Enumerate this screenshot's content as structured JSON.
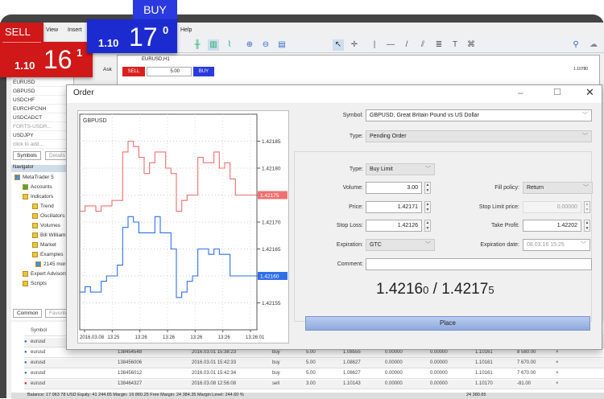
{
  "menu": [
    "View",
    "Insert",
    "Help"
  ],
  "one_click": {
    "sell_label": "SELL",
    "sell_big": "1.10",
    "sell_digits": "16",
    "sell_sup": "1",
    "buy_label": "BUY",
    "buy_big": "1.10",
    "buy_digits": "17",
    "buy_sup": "0"
  },
  "bg_chart": {
    "title": "EURUSD,H1",
    "sell": "SELL",
    "volume": "5.00",
    "buy": "BUY",
    "price_label": "1.10780",
    "ask_header": "Ask"
  },
  "market_watch": {
    "symbols": [
      "EURUSD",
      "GBPUSD",
      "USDCHF",
      "EURCHFCNH",
      "USDCADCT",
      "FORTS-USDR...",
      "USDJPY"
    ],
    "add": "click to add...",
    "tabs": [
      "Symbols",
      "Details"
    ]
  },
  "navigator": {
    "title": "Navigator",
    "items": [
      "MetaTrader 5",
      "Accounts",
      "Indicators",
      "Trend",
      "Oscillators",
      "Volumes",
      "Bill Williams",
      "Market",
      "Examples",
      "2145 more...",
      "Expert Advisors",
      "Scripts"
    ],
    "tabs": [
      "Common",
      "Favorites"
    ]
  },
  "dialog": {
    "title": "Order",
    "symbol_label": "Symbol:",
    "symbol_value": "GBPUSD, Great Britain Pound vs US Dollar",
    "type_label": "Type:",
    "type_value": "Pending Order",
    "order_type_label": "Type:",
    "order_type_value": "Buy Limit",
    "volume_label": "Volume:",
    "volume_value": "3.00",
    "fill_label": "Fill policy:",
    "fill_value": "Return",
    "price_label": "Price:",
    "price_value": "1.42171",
    "stop_limit_label": "Stop Limit price:",
    "stop_limit_value": "0.00000",
    "sl_label": "Stop Loss:",
    "sl_value": "1.42126",
    "tp_label": "Take Profit:",
    "tp_value": "1.42202",
    "exp_label": "Expiration:",
    "exp_value": "GTC",
    "exp_date_label": "Expiration date:",
    "exp_date_value": "08.03.16 15:25",
    "comment_label": "Comment:",
    "comment_value": "",
    "bid_main": "1.4216",
    "bid_small": "0",
    "sep": " / ",
    "ask_main": "1.4217",
    "ask_small": "5",
    "place_label": "Place"
  },
  "chart_data": {
    "type": "line",
    "title": "GBPUSD",
    "x_tick_labels": [
      "2016.03.08",
      "13:25",
      "13:26",
      "13:26",
      "13:26",
      "13:26",
      "13:26:01"
    ],
    "y_ticks": [
      1.42155,
      1.4216,
      1.42165,
      1.4217,
      1.42175,
      1.4218,
      1.42185
    ],
    "ylim": [
      1.4215,
      1.4219
    ],
    "grid": true,
    "current_ask_label": "1.42175",
    "current_bid_label": "1.42160",
    "series": [
      {
        "color": "#f07070",
        "values": [
          1.42172,
          1.42173,
          1.42173,
          1.42172,
          1.42173,
          1.42173,
          1.42174,
          1.42174,
          1.42183,
          1.42185,
          1.42184,
          1.42182,
          1.42179,
          1.42181,
          1.42183,
          1.42183,
          1.4218,
          1.42179,
          1.42172,
          1.42174,
          1.42175,
          1.42175,
          1.42182,
          1.42181,
          1.42181,
          1.42183,
          1.4218,
          1.42181,
          1.42178,
          1.42175,
          1.42175,
          1.42175,
          1.42175,
          1.42175
        ]
      },
      {
        "color": "#2f6fe8",
        "values": [
          1.42157,
          1.42158,
          1.42157,
          1.42157,
          1.42159,
          1.4216,
          1.4216,
          1.42162,
          1.42169,
          1.42171,
          1.4217,
          1.42168,
          1.42168,
          1.42168,
          1.42171,
          1.42168,
          1.42168,
          1.42165,
          1.42156,
          1.42157,
          1.42159,
          1.4216,
          1.42165,
          1.42165,
          1.42164,
          1.42165,
          1.42164,
          1.42164,
          1.4216,
          1.4216,
          1.4216,
          1.4216,
          1.4216,
          1.4216
        ]
      }
    ]
  },
  "toolbox": {
    "header": "Symbol",
    "rows": [
      [
        "eurusd",
        "",
        "",
        "",
        "",
        "",
        "",
        "",
        "",
        ""
      ],
      [
        "eurusd",
        "138454548",
        "2016.03.01 15:38:23",
        "buy",
        "5.00",
        "1.08555",
        "0.00000",
        "0.00000",
        "1.10161",
        "8 580.00"
      ],
      [
        "eurusd",
        "138456006",
        "2016.03.01 15:42:33",
        "buy",
        "5.00",
        "1.08627",
        "0.00000",
        "0.00000",
        "1.10161",
        "7 670.00"
      ],
      [
        "eurusd",
        "138456012",
        "2016.03.01 15:42:34",
        "buy",
        "5.00",
        "1.08627",
        "0.00000",
        "0.00000",
        "1.10161",
        "7 670.00"
      ],
      [
        "eurusd",
        "138464327",
        "2016.03.08 12:56:08",
        "sell",
        "3.00",
        "1.10143",
        "0.00000",
        "0.00000",
        "1.10170",
        "-81.00"
      ]
    ],
    "balance": "Balance: 17 063 78 USD  Equity: 41 244.65  Margin: 16 860.25  Free Margin: 24 384.35  Margin Level: 244.60 %",
    "total": "24 380.65"
  }
}
